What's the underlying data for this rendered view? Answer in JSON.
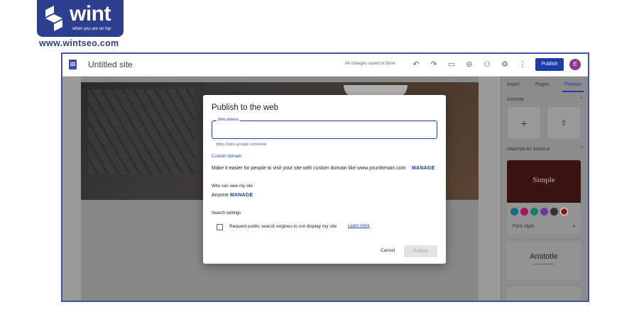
{
  "brand": {
    "name": "wint",
    "tagline": "when you are on top",
    "url": "www.wintseo.com"
  },
  "toolbar": {
    "site_title": "Untitled site",
    "saved_status": "All changes saved in Drive",
    "publish_label": "Publish",
    "avatar_letter": "E",
    "icons": [
      "undo-icon",
      "redo-icon",
      "preview-devices-icon",
      "link-icon",
      "add-person-icon",
      "settings-icon",
      "more-vert-icon"
    ]
  },
  "side_panel": {
    "tabs": [
      "Insert",
      "Pages",
      "Themes"
    ],
    "active_tab": "Themes",
    "custom_section": "CUSTOM",
    "google_section": "CREATED BY GOOGLE",
    "add_tile": "+",
    "upload_tile": "⇪",
    "themes": [
      {
        "name": "Simple",
        "font_style_label": "Font style"
      },
      {
        "name": "Aristotle"
      }
    ],
    "swatch_colors": [
      "#1a6b8a",
      "#a0185a",
      "#1a7a6a",
      "#6a3b9a",
      "#333333",
      "#8a1a1a"
    ]
  },
  "dialog": {
    "title": "Publish to the web",
    "web_address_label": "Web address",
    "web_address_value": "",
    "url_helper": "https://sites.google.com/view/",
    "custom_domain_heading": "Custom domain",
    "custom_domain_text": "Make it easier for people to visit your site with custom domain like www.yourdomain.com",
    "manage_label": "MANAGE",
    "who_can_view_heading": "Who can view my site",
    "who_can_view_value": "Anyone",
    "search_settings_heading": "Search settings",
    "search_checkbox_label": "Request public search engines to not display my site",
    "learn_more": "Learn more",
    "cancel_label": "Cancel",
    "publish_label": "Publish"
  }
}
